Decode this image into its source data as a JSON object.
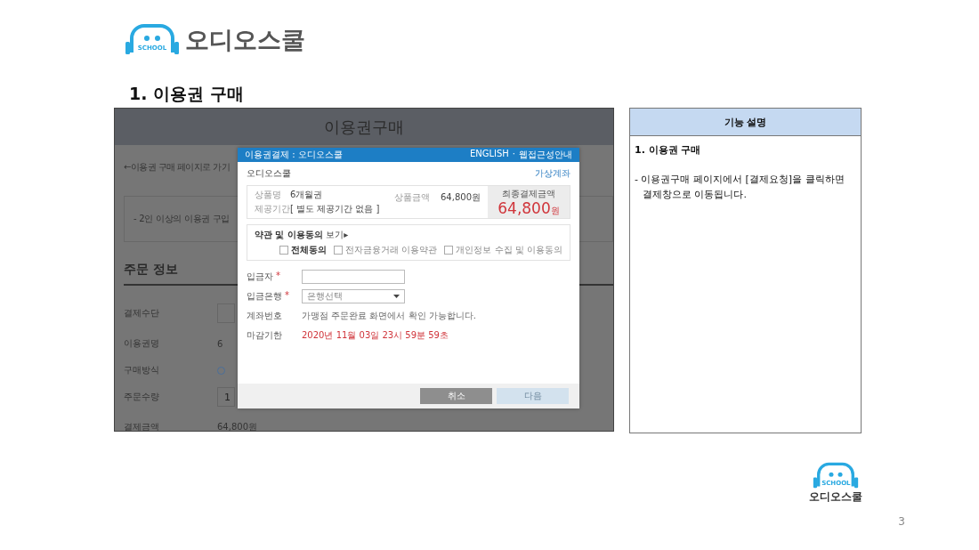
{
  "logo": {
    "badge": "SCHOOL",
    "name": "오디오스쿨"
  },
  "heading": "1. 이용권 구매",
  "screenshot": {
    "page_title": "이용권구매",
    "back_link": "←이용권 구매 페이지로 가기",
    "notice": "- 2인 이상의 이용권 구입",
    "section_title": "주문 정보",
    "rows": [
      {
        "kind": "field",
        "label": "결제수단"
      },
      {
        "kind": "text",
        "label": "이용권명",
        "value": "6"
      },
      {
        "kind": "radio",
        "label": "구매방식",
        "selected": false
      },
      {
        "kind": "field",
        "label": "주문수량",
        "value": "1"
      },
      {
        "kind": "text",
        "label": "결제금액",
        "value": "64,800원"
      }
    ],
    "modal": {
      "title": "이용권결제 : 오디오스쿨",
      "links": [
        "ENGLISH",
        "웹접근성안내"
      ],
      "separator": "·",
      "merchant": "오디오스쿨",
      "method": "가상계좌",
      "summary": {
        "product_label": "상품명",
        "product": "6개월권",
        "period_label": "제공기간",
        "period": "[ 별도 제공기간 없음 ]",
        "price_label": "상품금액",
        "price": "64,800원",
        "total_label": "최종결제금액",
        "total": "64,800",
        "total_unit": "원"
      },
      "terms": {
        "label": "약관 및 이용동의",
        "view": "보기▸"
      },
      "checkboxes": [
        {
          "kind": "all",
          "label": "전체동의",
          "checked": false
        },
        {
          "kind": "item",
          "label": "전자금융거래 이용약관",
          "checked": false
        },
        {
          "kind": "item",
          "label": "개인정보 수집 및 이용동의",
          "checked": false
        }
      ],
      "fields": [
        {
          "kind": "input",
          "label": "입금자",
          "mark": "*"
        },
        {
          "kind": "select",
          "label": "입금은행",
          "mark": "*",
          "value": "은행선택"
        },
        {
          "kind": "note",
          "label": "계좌번호",
          "value": "가맹점 주문완료 화면에서 확인 가능합니다."
        },
        {
          "kind": "deadline",
          "label": "마감기한",
          "value": "2020년 11월 03일 23시 59분 59초"
        }
      ],
      "buttons": [
        {
          "label": "취소",
          "disabled": false
        },
        {
          "label": "다음",
          "disabled": true
        }
      ]
    }
  },
  "description": {
    "header": "기능 설명",
    "title": "1. 이용권 구매",
    "text": "- 이용권구매 페이지에서 [결제요청]을 클릭하면 결제창으로 이동됩니다."
  },
  "footer_logo": {
    "badge": "SCHOOL",
    "name": "오디오스쿨"
  },
  "page_number": "3"
}
